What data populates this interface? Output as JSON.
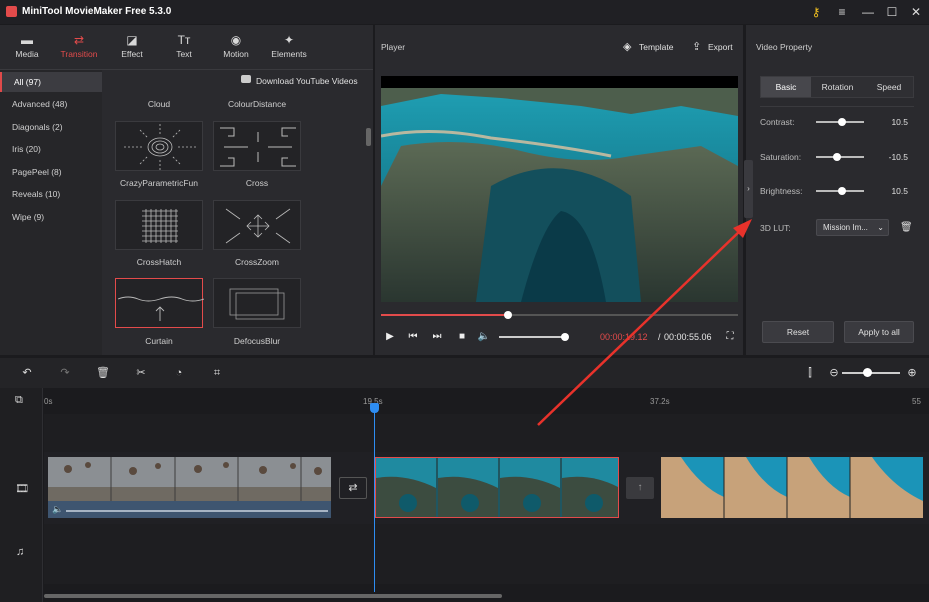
{
  "app": {
    "title": "MiniTool MovieMaker Free 5.3.0"
  },
  "window_controls": {
    "key": "⚷",
    "menu": "≡",
    "minimize": "—",
    "maximize": "☐",
    "close": "✕"
  },
  "top_tabs": [
    {
      "label": "Media",
      "icon": "▬"
    },
    {
      "label": "Transition",
      "icon": "⇄"
    },
    {
      "label": "Effect",
      "icon": "◪"
    },
    {
      "label": "Text",
      "icon": "Tт"
    },
    {
      "label": "Motion",
      "icon": "◉"
    },
    {
      "label": "Elements",
      "icon": "✦"
    }
  ],
  "categories": [
    "All (97)",
    "Advanced (48)",
    "Diagonals (2)",
    "Iris (20)",
    "PagePeel (8)",
    "Reveals (10)",
    "Wipe (9)"
  ],
  "download_link": "Download YouTube Videos",
  "transitions": {
    "top_labels": [
      "Cloud",
      "ColourDistance"
    ],
    "items": [
      "CrazyParametricFun",
      "Cross",
      "CrossHatch",
      "CrossZoom",
      "Curtain",
      "DefocusBlur"
    ]
  },
  "player": {
    "title": "Player",
    "template_label": "Template",
    "export_label": "Export",
    "time_current": "00:00:19.12",
    "time_separator": "/",
    "time_total": "00:00:55.06",
    "progress": 0.355,
    "volume": 1.0
  },
  "properties": {
    "title": "Video Property",
    "tabs": [
      "Basic",
      "Rotation",
      "Speed"
    ],
    "contrast": {
      "label": "Contrast:",
      "value": "10.5"
    },
    "saturation": {
      "label": "Saturation:",
      "value": "-10.5"
    },
    "brightness": {
      "label": "Brightness:",
      "value": "10.5"
    },
    "lut": {
      "label": "3D LUT:",
      "value": "Mission Im..."
    },
    "reset_label": "Reset",
    "apply_label": "Apply to all"
  },
  "timeline": {
    "ruler": [
      "0s",
      "19.5s",
      "37.2s",
      "55"
    ]
  },
  "colors": {
    "accent": "#e34b4b",
    "playhead": "#2e8df2",
    "panel": "#2a2a2e"
  }
}
